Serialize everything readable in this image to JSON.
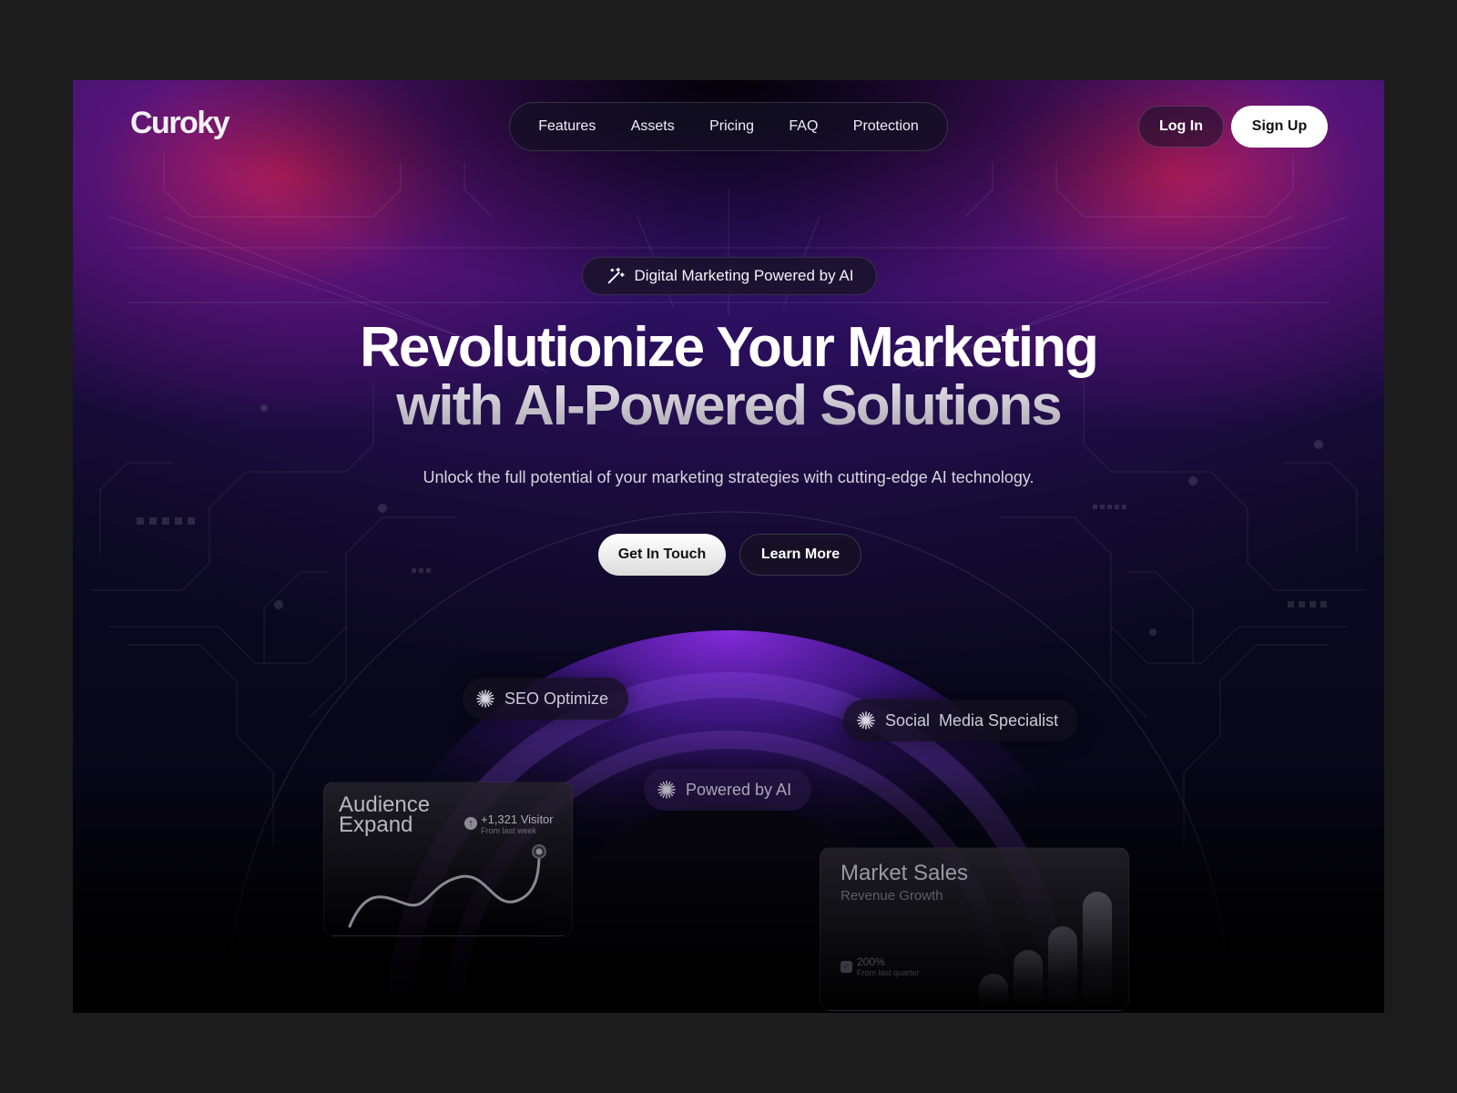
{
  "header": {
    "logo": "Curoky",
    "nav": [
      {
        "label": "Features"
      },
      {
        "label": "Assets"
      },
      {
        "label": "Pricing"
      },
      {
        "label": "FAQ"
      },
      {
        "label": "Protection"
      }
    ],
    "login_label": "Log In",
    "signup_label": "Sign Up"
  },
  "hero": {
    "badge": {
      "icon": "magic-wand-icon",
      "label": "Digital Marketing Powered by AI"
    },
    "title_line1": "Revolutionize Your Marketing",
    "title_line2": "with AI-Powered Solutions",
    "subtitle": "Unlock the full potential of your marketing strategies with cutting-edge AI technology.",
    "primary_cta": "Get In Touch",
    "secondary_cta": "Learn More"
  },
  "features": {
    "pills": [
      {
        "icon": "sparkle-icon",
        "label": "SEO Optimize"
      },
      {
        "icon": "sparkle-icon",
        "label": "Social  Media Specialist"
      },
      {
        "icon": "sparkle-icon",
        "label": "Powered by AI"
      }
    ]
  },
  "audience_card": {
    "title": "Audience Expand",
    "stat": "+1,321 Visitor",
    "stat_sub": "From last week"
  },
  "market_card": {
    "title": "Market Sales",
    "subtitle": "Revenue Growth",
    "stat": "200%",
    "stat_sub": "From last quarter"
  },
  "colors": {
    "page_bg": "#1c1c1c",
    "accent_purple": "#7a2ad6",
    "accent_magenta": "#c81e5a",
    "text_primary": "#ffffff"
  }
}
